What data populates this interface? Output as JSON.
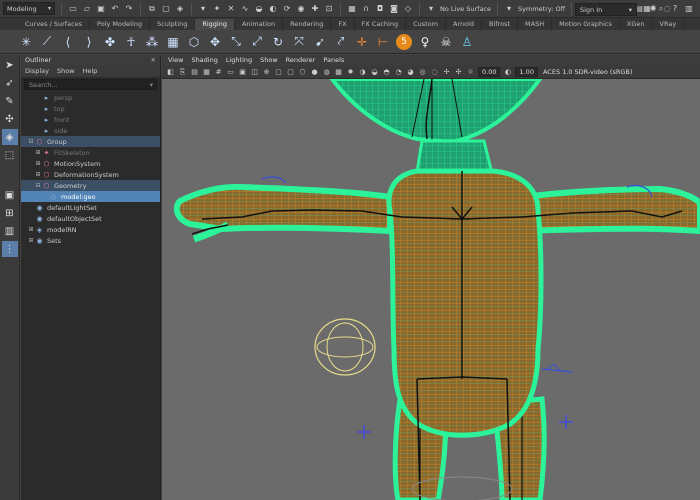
{
  "toolbar": {
    "mode": "Modeling",
    "live_surface": "No Live Surface",
    "symmetry": "Symmetry: Off",
    "sign_in": "Sign In"
  },
  "shelf_tabs": [
    "Curves / Surfaces",
    "Poly Modeling",
    "Sculpting",
    "Rigging",
    "Animation",
    "Rendering",
    "FX",
    "FX Caching",
    "Custom",
    "Arnold",
    "Bifrost",
    "MASH",
    "Motion Graphics",
    "XGen",
    "VRay"
  ],
  "active_shelf_tab": "Rigging",
  "outliner": {
    "title": "Outliner",
    "menus": [
      "Display",
      "Show",
      "Help"
    ],
    "search_placeholder": "Search...",
    "rows": [
      {
        "label": "persp",
        "indent": 1,
        "state": "dim",
        "icon": "camera-icon"
      },
      {
        "label": "top",
        "indent": 1,
        "state": "dim",
        "icon": "camera-icon"
      },
      {
        "label": "front",
        "indent": 1,
        "state": "dim",
        "icon": "camera-icon"
      },
      {
        "label": "side",
        "indent": 1,
        "state": "dim",
        "icon": "camera-icon"
      },
      {
        "label": "Group",
        "indent": 0,
        "state": "hl",
        "icon": "group-icon",
        "expander": "minus"
      },
      {
        "label": "FitSkeleton",
        "indent": 1,
        "state": "dim",
        "icon": "joint-icon",
        "expander": "plus"
      },
      {
        "label": "MotionSystem",
        "indent": 1,
        "state": "normal",
        "icon": "group-icon",
        "expander": "plus"
      },
      {
        "label": "DeformationSystem",
        "indent": 1,
        "state": "normal",
        "icon": "group-icon",
        "expander": "plus"
      },
      {
        "label": "Geometry",
        "indent": 1,
        "state": "hl",
        "icon": "group-icon",
        "expander": "minus"
      },
      {
        "label": "model:geo",
        "indent": 2,
        "state": "sel",
        "icon": "mesh-icon"
      },
      {
        "label": "defaultLightSet",
        "indent": 0,
        "state": "normal",
        "icon": "set-icon"
      },
      {
        "label": "defaultObjectSet",
        "indent": 0,
        "state": "normal",
        "icon": "set-icon"
      },
      {
        "label": "modelRN",
        "indent": 0,
        "state": "normal",
        "icon": "reference-icon",
        "expander": "plus"
      },
      {
        "label": "Sets",
        "indent": 0,
        "state": "normal",
        "icon": "set-icon",
        "expander": "plus"
      }
    ]
  },
  "viewport": {
    "menus": [
      "View",
      "Shading",
      "Lighting",
      "Show",
      "Renderer",
      "Panels"
    ],
    "exposure": "0.00",
    "gamma": "1.00",
    "color_space": "ACES 1.0 SDR-video (sRGB)"
  },
  "colors": {
    "wire_green": "#2cf29a",
    "wire_orange": "#e08a2a",
    "viewport_bg": "#6b6b6b",
    "joint": "#111111",
    "control_blue": "#3e4fd6"
  }
}
